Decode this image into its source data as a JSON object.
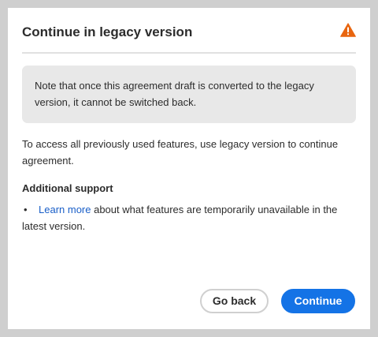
{
  "dialog": {
    "title": "Continue in legacy version",
    "warning_icon": "warning-triangle-icon",
    "note": "Note that once this agreement draft is converted to the legacy version, it cannot be switched back.",
    "body": "To access all previously used features, use legacy version to continue agreement.",
    "support_heading": "Additional support",
    "support_item": {
      "bullet": "•",
      "link_text": "Learn more",
      "text": " about what features are temporarily unavailable in the latest version."
    },
    "buttons": {
      "back_label": "Go back",
      "continue_label": "Continue"
    }
  },
  "colors": {
    "backdrop": "#cfcfcf",
    "note_background": "#e8e8e8",
    "warning": "#e8650f",
    "link": "#1a5fc8",
    "primary_button": "#1473e6"
  }
}
